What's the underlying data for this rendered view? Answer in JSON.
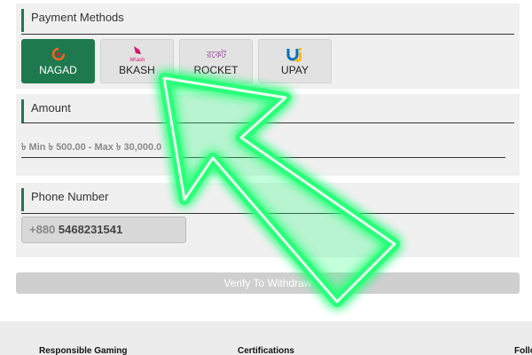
{
  "payment_methods": {
    "title": "Payment Methods",
    "items": [
      {
        "label": "NAGAD",
        "icon": "nagad-logo-icon",
        "active": true
      },
      {
        "label": "BKASH",
        "icon": "bkash-logo-icon",
        "logo_text": "bKash"
      },
      {
        "label": "ROCKET",
        "icon": "rocket-logo-icon",
        "logo_text": "রকেট"
      },
      {
        "label": "UPAY",
        "icon": "upay-logo-icon"
      }
    ]
  },
  "amount": {
    "title": "Amount",
    "range_text": "৳ Min ৳ 500.00 - Max ৳ 30,000.0"
  },
  "phone": {
    "title": "Phone Number",
    "prefix": "+880",
    "value": "5468231541"
  },
  "actions": {
    "verify_label": "Verify To Withdraw"
  },
  "footer": {
    "links": [
      "Responsible Gaming",
      "Certifications",
      "Follo"
    ]
  },
  "colors": {
    "accent": "#1e7a4e",
    "arrow": "#39ff7a",
    "panel": "#f0f0f0"
  }
}
